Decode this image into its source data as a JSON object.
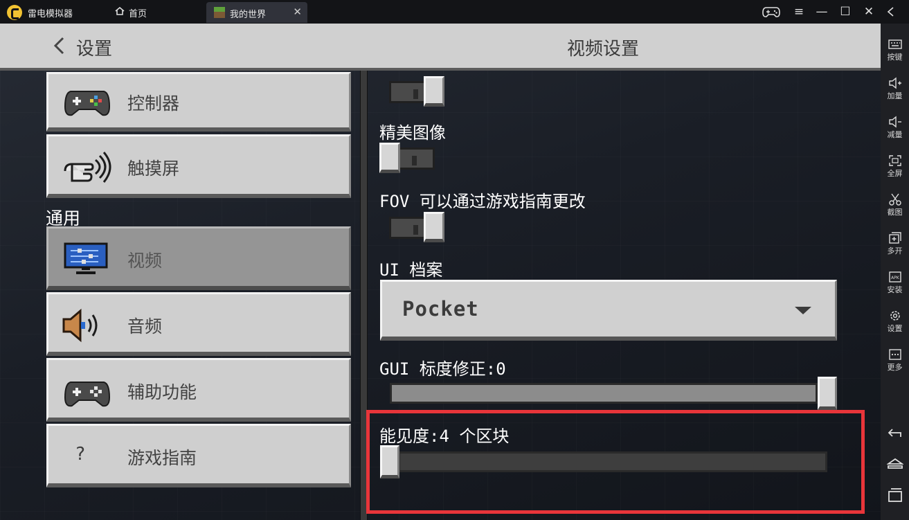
{
  "emulator": {
    "app_name": "雷电模拟器",
    "tabs": [
      {
        "label": "首页"
      },
      {
        "label": "我的世界"
      }
    ],
    "tab_close": "✕",
    "controls": {
      "minimize": "—",
      "maximize": "☐",
      "close": "✕",
      "menu": "≡"
    }
  },
  "sidebar": {
    "items": [
      {
        "label": "按键",
        "icon": "keyboard-icon"
      },
      {
        "label": "加量",
        "icon": "volume-up-icon"
      },
      {
        "label": "减量",
        "icon": "volume-down-icon"
      },
      {
        "label": "全屏",
        "icon": "fullscreen-icon"
      },
      {
        "label": "截图",
        "icon": "scissors-icon"
      },
      {
        "label": "多开",
        "icon": "multi-instance-icon"
      },
      {
        "label": "安装",
        "icon": "apk-install-icon"
      },
      {
        "label": "设置",
        "icon": "gear-icon"
      },
      {
        "label": "更多",
        "icon": "more-icon"
      }
    ],
    "nav": [
      "back-icon",
      "home-icon",
      "recents-icon"
    ]
  },
  "header": {
    "back_title": "设置",
    "title": "视频设置"
  },
  "left_nav": {
    "items_top": [
      {
        "label": "控制器",
        "icon": "controller-icon"
      },
      {
        "label": "触摸屏",
        "icon": "touch-icon"
      }
    ],
    "section_title": "通用",
    "items_general": [
      {
        "label": "视频",
        "icon": "monitor-icon",
        "selected": true
      },
      {
        "label": "音频",
        "icon": "speaker-icon",
        "selected": false
      },
      {
        "label": "辅助功能",
        "icon": "controller-icon",
        "selected": false
      },
      {
        "label": "游戏指南",
        "icon": "question-icon",
        "selected": false
      }
    ],
    "question_glyph": "?"
  },
  "settings": {
    "fancy_graphics_label": "精美图像",
    "fov_label": "FOV 可以通过游戏指南更改",
    "ui_profile_label": "UI 档案",
    "ui_profile_value": "Pocket",
    "gui_scale_label": "GUI 标度修正:0",
    "gui_scale_value": 1.0,
    "render_distance_label": "能见度:4 个区块",
    "render_distance_value": 0.0,
    "toggles": {
      "top_toggle": true,
      "fancy_graphics": false,
      "fov_toggle": true
    }
  },
  "colors": {
    "highlight": "#e8353a",
    "selected_nav": "#959595"
  }
}
